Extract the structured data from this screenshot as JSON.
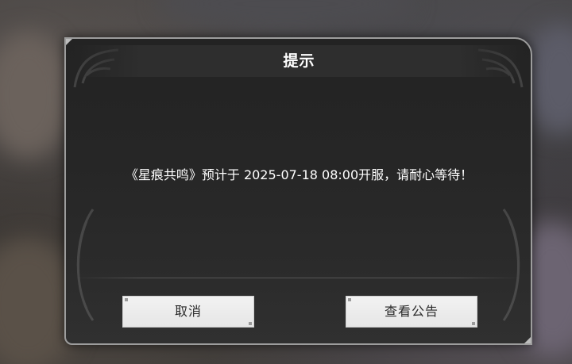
{
  "dialog": {
    "title": "提示",
    "message": "《星痕共鸣》预计于 2025-07-18 08:00开服，请耐心等待！",
    "buttons": {
      "cancel": "取消",
      "view_announcement": "查看公告"
    }
  },
  "colors": {
    "panel": "#262626",
    "border": "#9d9d9d",
    "text": "#ffffff",
    "button_bg": "#efefef",
    "button_text": "#2a2a2a"
  }
}
